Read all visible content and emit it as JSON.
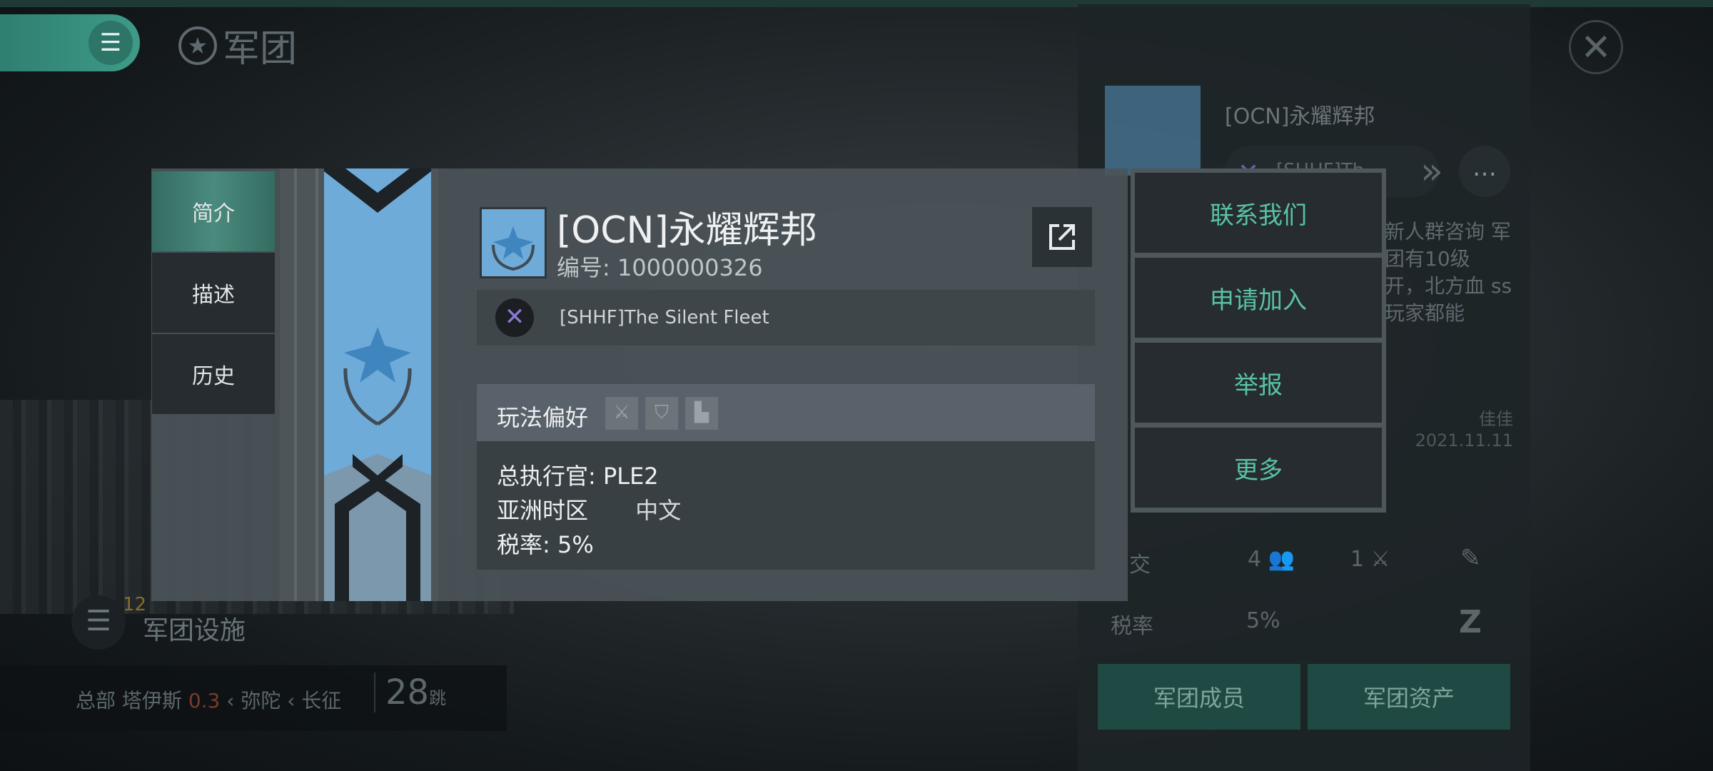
{
  "header": {
    "title": "军团",
    "menu_icon": "menu-icon",
    "close_icon": "close-icon"
  },
  "tabs": [
    {
      "label": "简介",
      "active": true
    },
    {
      "label": "描述",
      "active": false
    },
    {
      "label": "历史",
      "active": false
    }
  ],
  "guild": {
    "name": "[OCN]永耀辉邦",
    "id_line": "编号: 1000000326",
    "alliance": "[SHHF]The Silent Fleet",
    "preferences_label": "玩法偏好",
    "ceo": "总执行官: PLE2",
    "timezone": "亚洲时区",
    "language": "中文",
    "tax": "税率: 5%"
  },
  "actions": [
    "联系我们",
    "申请加入",
    "举报",
    "更多"
  ],
  "right_panel": {
    "name": "[OCN]永耀辉邦",
    "alliance_short": "[SHHF]Th...",
    "description": "新人群咨询 军团有10级 开，北方血 ss 玩家都能",
    "author": "佳佳",
    "date": "2021.11.11",
    "diplomacy_label": "交",
    "members_count": "4",
    "wars_count": "1",
    "tax_label": "税率",
    "tax_value": "5%",
    "members_button": "军团成员",
    "assets_button": "军团资产"
  },
  "facilities": {
    "label": "军团设施",
    "badge": "12"
  },
  "route": {
    "text_hq": "总部 塔伊斯",
    "security": "0.3",
    "waypoint1": "弥陀",
    "waypoint2": "长征",
    "jumps": "28",
    "jumps_unit": "跳"
  },
  "colors": {
    "accent": "#59c2a8",
    "banner": "#6eabd9",
    "tab_active": "#4a8b7e"
  }
}
